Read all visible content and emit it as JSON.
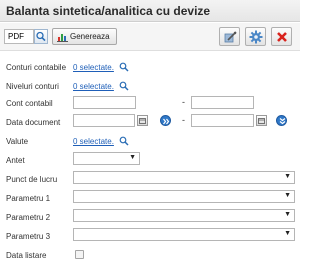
{
  "title": "Balanta sintetica/analitica cu devize",
  "toolbar": {
    "format_value": "PDF",
    "generate_label": "Genereaza"
  },
  "form": {
    "conturi_contabile": {
      "label": "Conturi contabile",
      "link": "0 selectate."
    },
    "niveluri_conturi": {
      "label": "Niveluri conturi",
      "link": "0 selectate."
    },
    "cont_contabil": {
      "label": "Cont contabil",
      "separator": "-"
    },
    "data_document": {
      "label": "Data document",
      "separator": "-"
    },
    "valute": {
      "label": "Valute",
      "link": "0 selectate."
    },
    "antet": {
      "label": "Antet"
    },
    "punct_de_lucru": {
      "label": "Punct de lucru"
    },
    "parametru_1": {
      "label": "Parametru 1"
    },
    "parametru_2": {
      "label": "Parametru 2"
    },
    "parametru_3": {
      "label": "Parametru 3"
    },
    "data_listare": {
      "label": "Data listare"
    }
  },
  "dropdown_arrow": "▼",
  "icons": [
    "search-icon",
    "chart-icon",
    "edit-icon",
    "gear-icon",
    "close-icon",
    "calendar-icon",
    "forward-icon",
    "down-icon"
  ],
  "colors": {
    "link": "#1f5fb8",
    "close": "#d9231d",
    "accent": "#2f78c8"
  }
}
